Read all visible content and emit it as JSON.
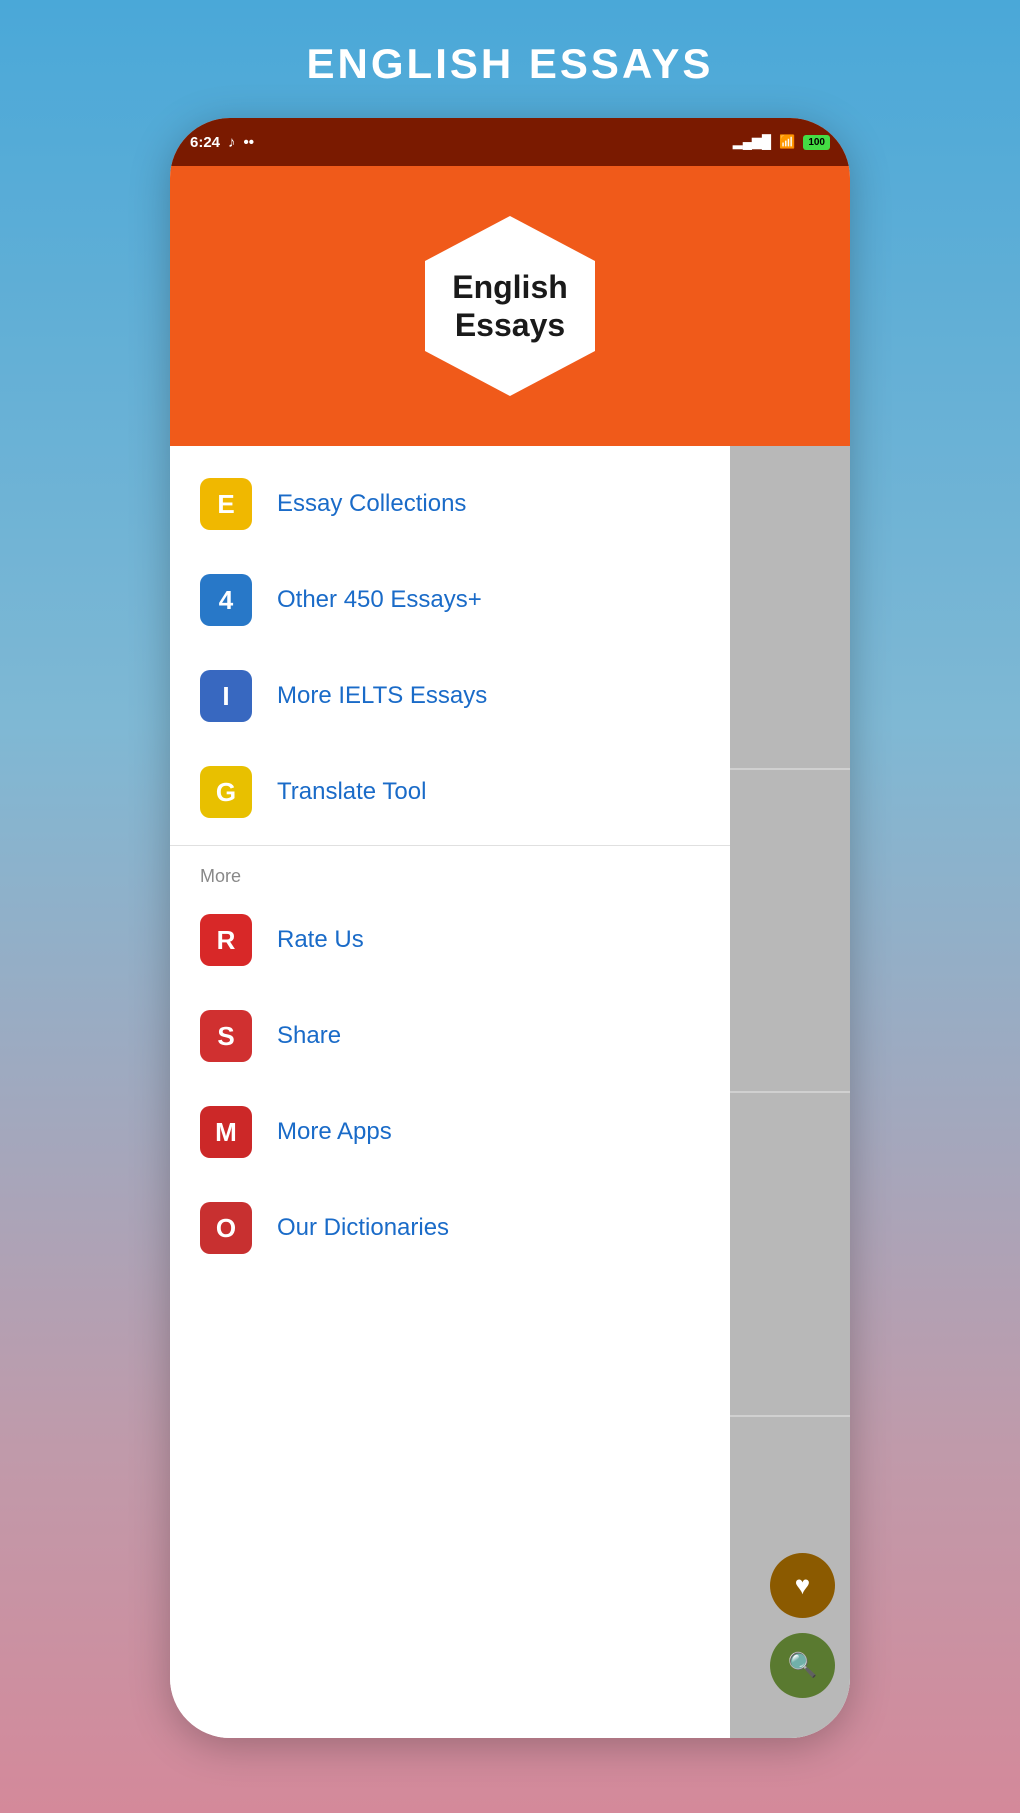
{
  "page": {
    "title": "ENGLISH ESSAYS"
  },
  "status_bar": {
    "time": "6:24",
    "battery": "100"
  },
  "app_header": {
    "logo_line1": "English",
    "logo_line2": "Essays"
  },
  "menu_items": [
    {
      "id": "essay-collections",
      "icon": "E",
      "icon_class": "icon-yellow",
      "label": "Essay Collections"
    },
    {
      "id": "other-essays",
      "icon": "4",
      "icon_class": "icon-blue",
      "label": "Other 450 Essays+"
    },
    {
      "id": "ielts-essays",
      "icon": "I",
      "icon_class": "icon-blue2",
      "label": "More IELTS Essays"
    },
    {
      "id": "translate-tool",
      "icon": "G",
      "icon_class": "icon-yellow2",
      "label": "Translate Tool"
    }
  ],
  "more_section": {
    "label": "More",
    "items": [
      {
        "id": "rate-us",
        "icon": "R",
        "icon_class": "icon-red",
        "label": "Rate Us"
      },
      {
        "id": "share",
        "icon": "S",
        "icon_class": "icon-red2",
        "label": "Share"
      },
      {
        "id": "more-apps",
        "icon": "M",
        "icon_class": "icon-red3",
        "label": "More Apps"
      },
      {
        "id": "our-dictionaries",
        "icon": "O",
        "icon_class": "icon-red4",
        "label": "Our Dictionaries"
      }
    ]
  }
}
